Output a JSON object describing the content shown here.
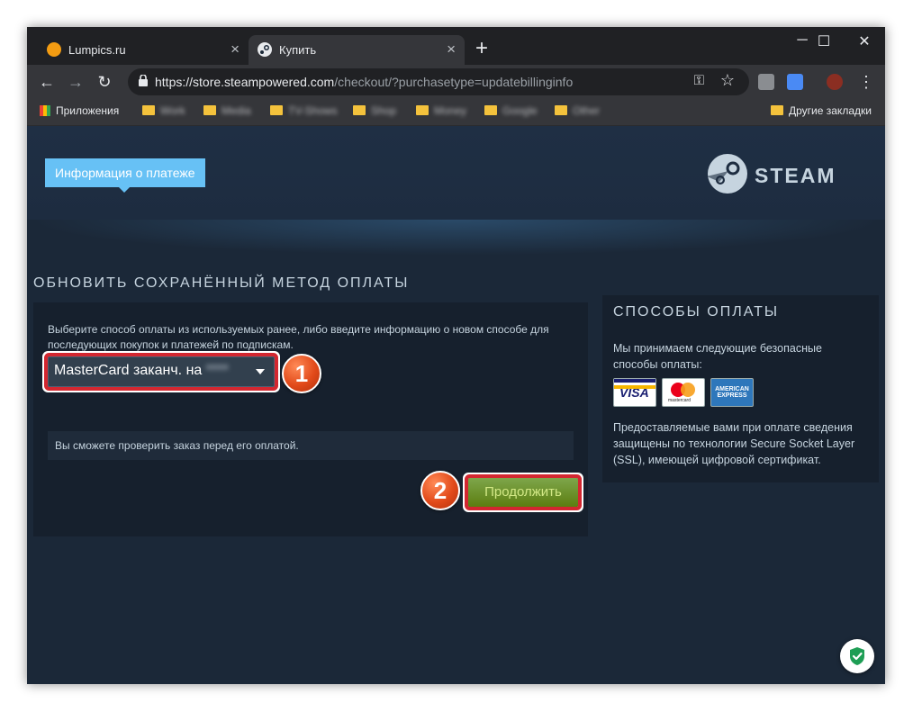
{
  "browser": {
    "tabs": [
      {
        "title": "Lumpics.ru",
        "favicon": "lumpics-icon"
      },
      {
        "title": "Купить",
        "favicon": "steam-icon"
      }
    ],
    "url_host": "https://store.steampowered.com",
    "url_rest": "/checkout/?purchasetype=updatebillinginfo",
    "bookmarks": {
      "apps_label": "Приложения",
      "folders": [
        "Work",
        "Media",
        "TV-Shows",
        "Shop",
        "Money",
        "Google",
        "Other"
      ],
      "other_label": "Другие закладки"
    }
  },
  "page": {
    "info_tab": "Информация о платеже",
    "logo_text": "STEAM",
    "title": "ОБНОВИТЬ СОХРАНЁННЫЙ МЕТОД ОПЛАТЫ",
    "description": "Выберите способ оплаты из используемых ранее, либо введите информацию о новом способе для последующих покупок и платежей по подпискам.",
    "payment_select": {
      "value": "MasterCard заканч. на",
      "masked_digits": "****"
    },
    "note": "Вы сможете проверить заказ перед его оплатой.",
    "continue_label": "Продолжить",
    "badges": {
      "one": "1",
      "two": "2"
    },
    "methods": {
      "title": "СПОСОБЫ ОПЛАТЫ",
      "accepted_text": "Мы принимаем следующие безопасные способы оплаты:",
      "cards": {
        "visa": "VISA",
        "mastercard": "mastercard",
        "amex": "AMERICAN EXPRESS"
      },
      "ssl_text": "Предоставляемые вами при оплате сведения защищены по технологии Secure Socket Layer (SSL), имеющей цифровой сертификат."
    }
  },
  "colors": {
    "accent": "#67c1f5",
    "page_bg": "#1b2838",
    "panel_bg": "#16202d",
    "highlight": "#d32730",
    "button": "#5c7e10"
  }
}
